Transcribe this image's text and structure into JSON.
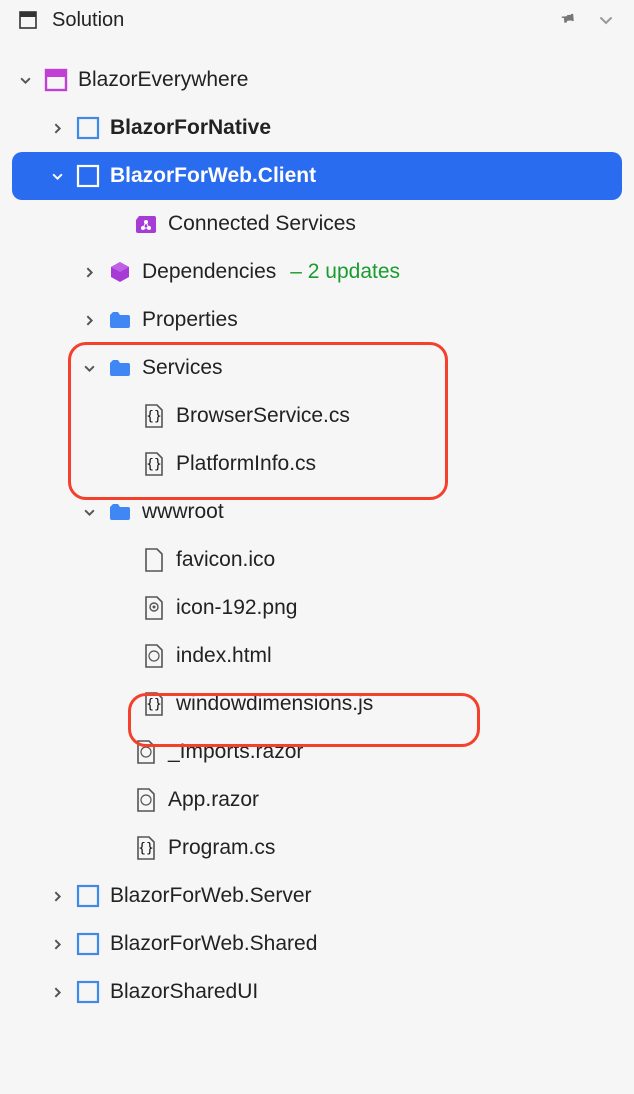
{
  "header": {
    "title": "Solution"
  },
  "tree": {
    "root": "BlazorEverywhere",
    "node_native": "BlazorForNative",
    "node_client": "BlazorForWeb.Client",
    "connected_services": "Connected Services",
    "dependencies": "Dependencies",
    "dependencies_badge": "– 2 updates",
    "properties": "Properties",
    "services": "Services",
    "browser_service": "BrowserService.cs",
    "platform_info": "PlatformInfo.cs",
    "wwwroot": "wwwroot",
    "favicon": "favicon.ico",
    "icon192": "icon-192.png",
    "indexhtml": "index.html",
    "windowdim": "windowdimensions.js",
    "imports": "_Imports.razor",
    "apprazor": "App.razor",
    "programcs": "Program.cs",
    "node_server": "BlazorForWeb.Server",
    "node_shared": "BlazorForWeb.Shared",
    "node_sharedui": "BlazorSharedUI"
  }
}
